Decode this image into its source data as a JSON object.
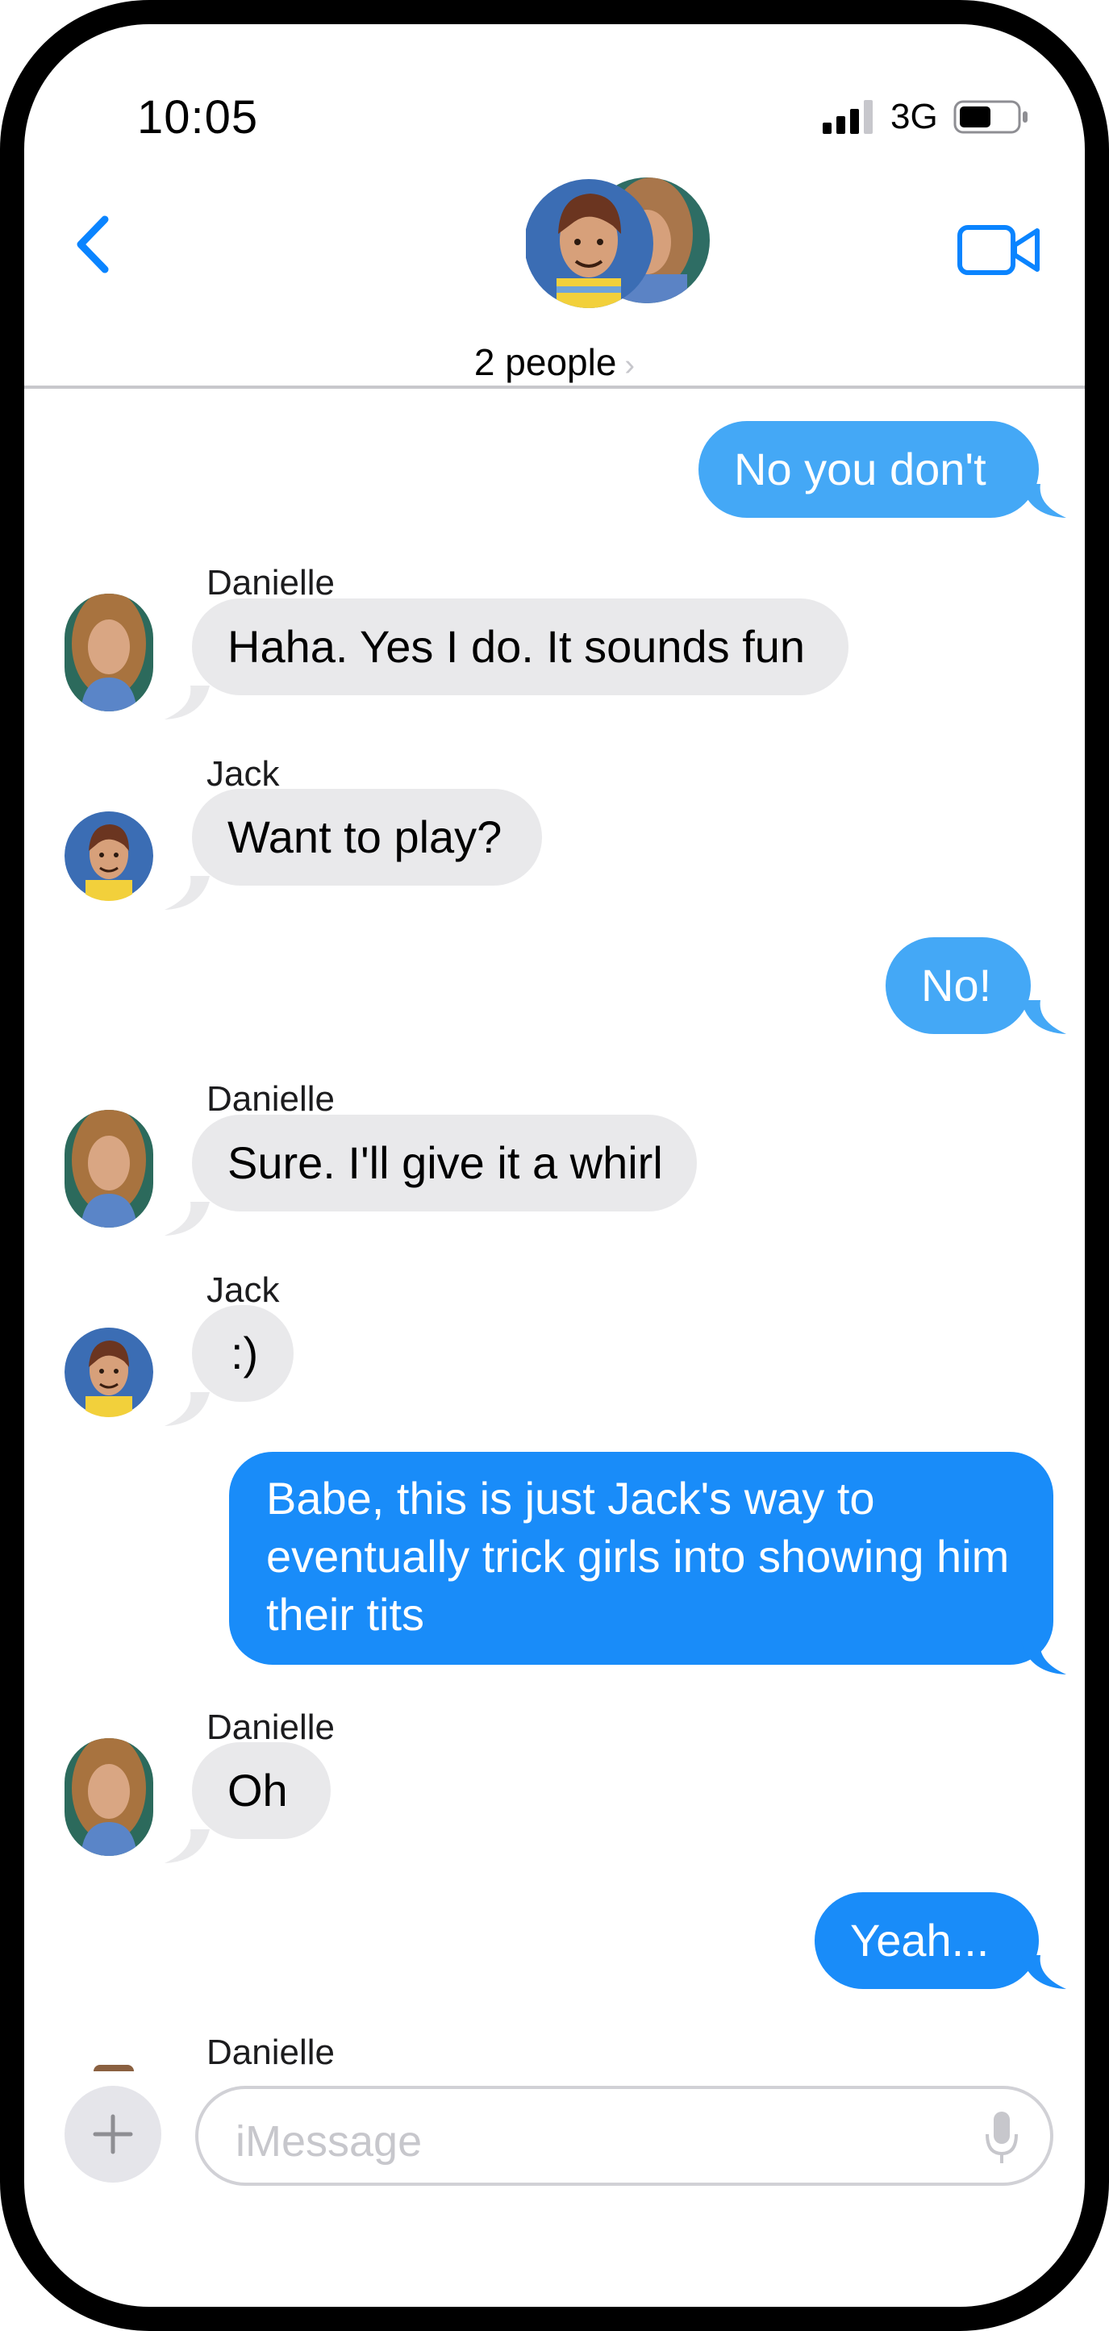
{
  "status_bar": {
    "time": "10:05",
    "network": "3G"
  },
  "header": {
    "group_label": "2 people",
    "chevron": "›"
  },
  "messages": [
    {
      "direction": "outgoing",
      "text": "No you don't"
    },
    {
      "direction": "incoming",
      "sender": "Danielle",
      "text": "Haha.  Yes I do.  It sounds fun"
    },
    {
      "direction": "incoming",
      "sender": "Jack",
      "text": "Want to play?"
    },
    {
      "direction": "outgoing",
      "text": "No!"
    },
    {
      "direction": "incoming",
      "sender": "Danielle",
      "text": "Sure.  I'll give it a whirl"
    },
    {
      "direction": "incoming",
      "sender": "Jack",
      "text": ":)"
    },
    {
      "direction": "outgoing",
      "lines": [
        "Babe, this is just Jack's way to",
        "eventually trick girls into showing him",
        "their tits"
      ]
    },
    {
      "direction": "incoming",
      "sender": "Danielle",
      "text": "Oh"
    },
    {
      "direction": "outgoing",
      "text": "Yeah..."
    },
    {
      "direction": "incoming",
      "sender": "Danielle"
    }
  ],
  "input": {
    "placeholder": "iMessage"
  },
  "colors": {
    "accent": "#0a84ff",
    "outgoing_light": "#44a8f6",
    "outgoing_dark": "#198cf9",
    "incoming": "#e9e9eb"
  },
  "icons": [
    "signal-icon",
    "battery-icon",
    "back-icon",
    "video-call-icon",
    "plus-icon",
    "microphone-icon"
  ]
}
